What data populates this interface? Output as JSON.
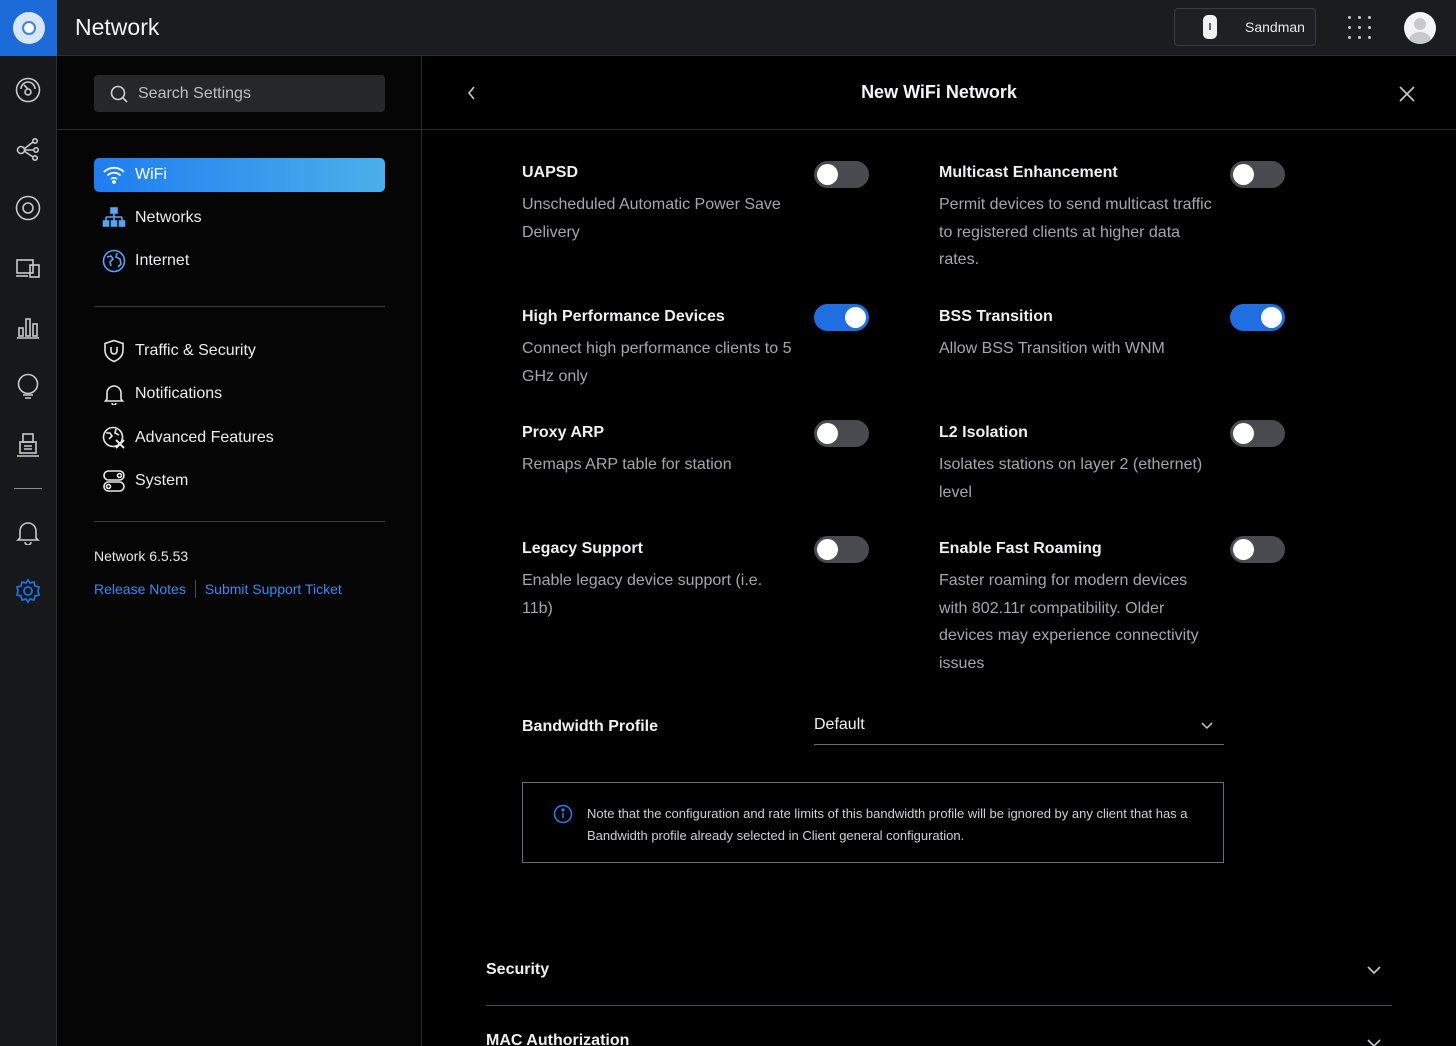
{
  "app": {
    "title": "Network"
  },
  "topbar": {
    "device_name": "Sandman"
  },
  "rail": {
    "icons": [
      "dashboard-icon",
      "topology-icon",
      "devices-icon",
      "clients-icon",
      "statistics-icon",
      "insights-icon",
      "system-log-icon",
      "alerts-icon",
      "settings-icon"
    ],
    "active_color": "#1f6fe0"
  },
  "sidebar": {
    "search_placeholder": "Search Settings",
    "items": [
      {
        "label": "WiFi",
        "icon": "wifi-icon"
      },
      {
        "label": "Networks",
        "icon": "networks-icon"
      },
      {
        "label": "Internet",
        "icon": "globe-icon"
      },
      {
        "label": "Traffic & Security",
        "icon": "shield-icon"
      },
      {
        "label": "Notifications",
        "icon": "bell-icon"
      },
      {
        "label": "Advanced Features",
        "icon": "advanced-icon"
      },
      {
        "label": "System",
        "icon": "system-icon"
      }
    ],
    "version": "Network 6.5.53",
    "release_notes": "Release Notes",
    "support_ticket": "Submit Support Ticket"
  },
  "panel": {
    "title": "New WiFi Network",
    "options": [
      {
        "title": "UAPSD",
        "desc": "Unscheduled Automatic Power Save Delivery",
        "enabled": false
      },
      {
        "title": "Multicast Enhancement",
        "desc": "Permit devices to send multicast traffic to registered clients at higher data rates.",
        "enabled": false
      },
      {
        "title": "High Performance Devices",
        "desc": "Connect high performance clients to 5 GHz only",
        "enabled": true
      },
      {
        "title": "BSS Transition",
        "desc": "Allow BSS Transition with WNM",
        "enabled": true
      },
      {
        "title": "Proxy ARP",
        "desc": "Remaps ARP table for station",
        "enabled": false
      },
      {
        "title": "L2 Isolation",
        "desc": "Isolates stations on layer 2 (ethernet) level",
        "enabled": false
      },
      {
        "title": "Legacy Support",
        "desc": "Enable legacy device support (i.e. 11b)",
        "enabled": false
      },
      {
        "title": "Enable Fast Roaming",
        "desc": "Faster roaming for modern devices with 802.11r compatibility. Older devices may experience connectivity issues",
        "enabled": false
      }
    ],
    "bandwidth": {
      "label": "Bandwidth Profile",
      "value": "Default",
      "note": "Note that the configuration and rate limits of this bandwidth profile will be ignored by any client that has a Bandwidth profile already selected in Client general configuration."
    },
    "sections": [
      "Security",
      "MAC Authorization"
    ]
  },
  "colors": {
    "accent": "#1f6fe0",
    "link": "#3a8bf2",
    "toggle_off": "#4a4b50"
  }
}
